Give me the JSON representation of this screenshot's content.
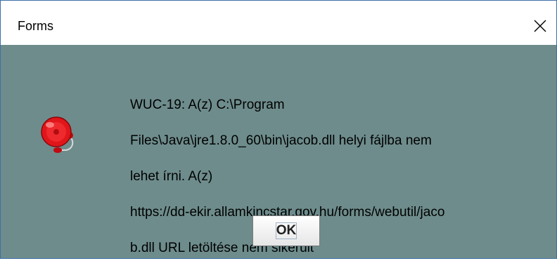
{
  "window": {
    "title": "Forms",
    "close_glyph": "✕"
  },
  "dialog": {
    "icon": "alarm-bell-icon",
    "message_lines": [
      "WUC-19: A(z) C:\\Program",
      "Files\\Java\\jre1.8.0_60\\bin\\jacob.dll helyi fájlba nem",
      "lehet írni. A(z)",
      "https://dd-ekir.allamkincstar.gov.hu/forms/webutil/jaco",
      "b.dll URL letöltése nem sikerült"
    ],
    "ok_label": "OK"
  },
  "colors": {
    "dialog_bg": "#6e8c8c",
    "bell_red": "#e0161a",
    "titlebar_bg": "#ffffff"
  }
}
